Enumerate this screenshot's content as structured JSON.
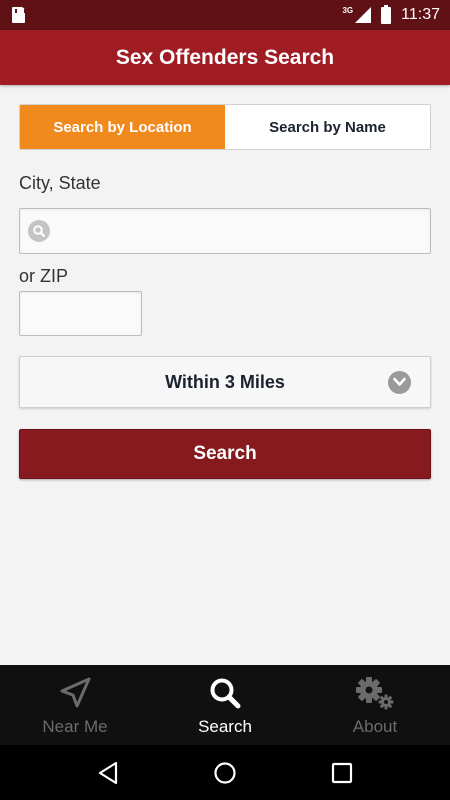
{
  "status_bar": {
    "network": "3G",
    "time": "11:37"
  },
  "app_bar": {
    "title": "Sex Offenders Search"
  },
  "search_tabs": [
    {
      "label": "Search by Location",
      "active": true
    },
    {
      "label": "Search by Name",
      "active": false
    }
  ],
  "form": {
    "city_label": "City, State",
    "city_value": "",
    "zip_label": "or ZIP",
    "zip_value": "",
    "distance_selected": "Within 3 Miles",
    "search_button_label": "Search"
  },
  "bottom_tabs": [
    {
      "label": "Near Me",
      "icon": "navigation-arrow-icon",
      "active": false
    },
    {
      "label": "Search",
      "icon": "search-icon",
      "active": true
    },
    {
      "label": "About",
      "icon": "gears-icon",
      "active": false
    }
  ],
  "colors": {
    "status_bar": "#5f1116",
    "app_bar": "#9e1c22",
    "active_tab": "#f08a1c",
    "search_button": "#861a1e",
    "tab_bar": "#101010"
  }
}
